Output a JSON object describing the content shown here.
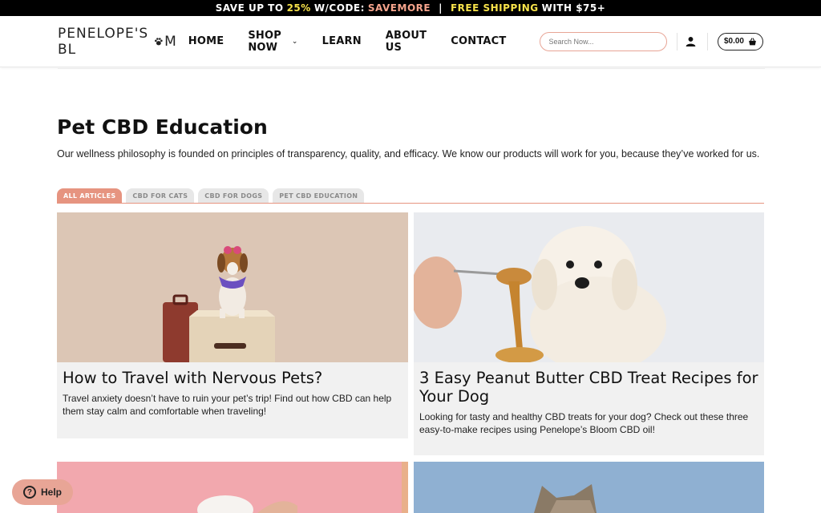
{
  "promo": {
    "part1": "SAVE UP TO",
    "percent": "25%",
    "part2": "W/CODE:",
    "code": "SAVEMORE",
    "divider": "|",
    "shipping": "FREE SHIPPING",
    "part3": "WITH $75+"
  },
  "header": {
    "logo_text_a": "PENELOPE'S BL",
    "logo_text_b": "M",
    "nav": [
      "HOME",
      "SHOP NOW",
      "LEARN",
      "ABOUT US",
      "CONTACT"
    ],
    "search_placeholder": "Search Now...",
    "cart_total": "$0.00"
  },
  "main": {
    "title": "Pet CBD Education",
    "description": "Our wellness philosophy is founded on principles of transparency, quality, and efficacy. We know our products will work for you, because they’ve worked for us.",
    "filters": [
      "ALL ARTICLES",
      "CBD FOR CATS",
      "CBD FOR DOGS",
      "PET CBD EDUCATION"
    ],
    "articles": [
      {
        "title": "How to Travel with Nervous Pets?",
        "excerpt": "Travel anxiety doesn’t have to ruin your pet’s trip! Find out how CBD can help them stay calm and comfortable when traveling!"
      },
      {
        "title": "3 Easy Peanut Butter CBD Treat Recipes for Your Dog",
        "excerpt": "Looking for tasty and healthy CBD treats for your dog? Check out these three easy-to-make recipes using Penelope’s Bloom CBD oil!"
      }
    ]
  },
  "help": {
    "label": "Help"
  },
  "colors": {
    "accent": "#e69480",
    "promo_bg": "#000000",
    "yellow": "#f7e24a",
    "card_bg": "#f1f1f1"
  }
}
